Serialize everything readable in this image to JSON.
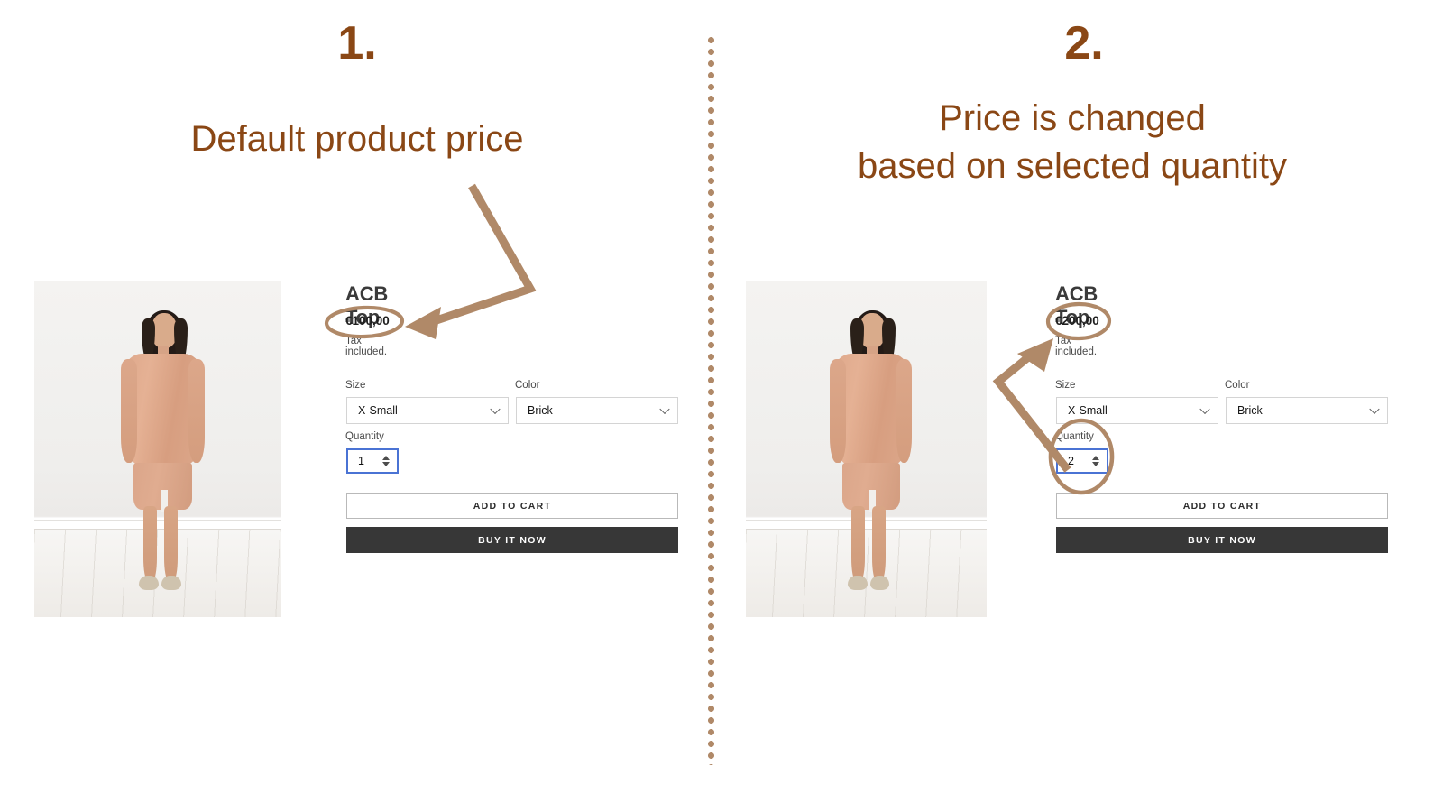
{
  "steps": [
    {
      "number": "1.",
      "title": "Default product price"
    },
    {
      "number": "2.",
      "title_line1": "Price is changed",
      "title_line2": "based on selected quantity"
    }
  ],
  "colors": {
    "heading": "#8a4715",
    "annotation": "#b08968",
    "buy_button_bg": "#373737",
    "quantity_focus_border": "#4a73d4"
  },
  "panels": [
    {
      "product_title": "ACB Top",
      "price": "€100,00",
      "tax_note": "Tax included.",
      "size_label": "Size",
      "size_value": "X-Small",
      "color_label": "Color",
      "color_value": "Brick",
      "quantity_label": "Quantity",
      "quantity_value": "1",
      "add_to_cart_label": "ADD TO CART",
      "buy_now_label": "BUY IT NOW"
    },
    {
      "product_title": "ACB Top",
      "price": "€200,00",
      "tax_note": "Tax included.",
      "size_label": "Size",
      "size_value": "X-Small",
      "color_label": "Color",
      "color_value": "Brick",
      "quantity_label": "Quantity",
      "quantity_value": "2",
      "add_to_cart_label": "ADD TO CART",
      "buy_now_label": "BUY IT NOW"
    }
  ]
}
